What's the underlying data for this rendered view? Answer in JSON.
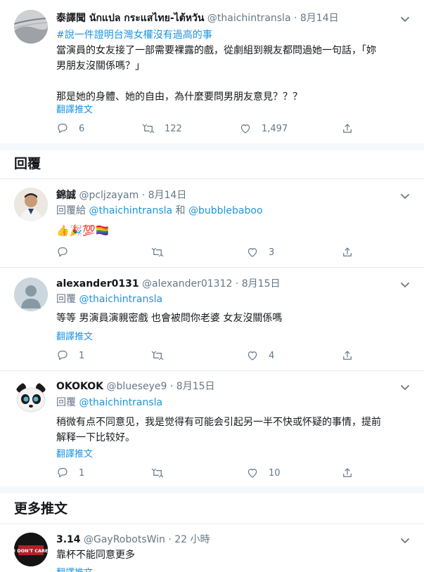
{
  "main_tweet": {
    "name": "泰譯聞 นักแปล กระแสไทย-ไต้หวัน",
    "handle": "@thaichintransla",
    "date": "· 8月14日",
    "hashtag": "#說一件證明台灣女權沒有過高的事",
    "line1": "當演員的女友接了一部需要裸露的戲，從劇組到親友都問過她一句話，「妳",
    "line2": "男朋友沒關係嗎？」",
    "line3": "那是她的身體、她的自由，為什麼要問男朋友意見？？？",
    "translate": "翻譯推文",
    "replies": "6",
    "retweets": "122",
    "likes": "1,497"
  },
  "replies_header": "回覆",
  "reply1": {
    "name": "錦誠",
    "handle": "@pcljzayam",
    "date": "· 8月14日",
    "reply_prefix": "回覆給",
    "reply_to1": "@thaichintransla",
    "reply_and": "和",
    "reply_to2": "@bubblebaboo",
    "emoji": "👍🎉💯🏳️‍🌈",
    "replies": "",
    "retweets": "",
    "likes": "3"
  },
  "reply2": {
    "name": "alexander0131",
    "handle": "@alexander01312",
    "date": "· 8月15日",
    "reply_prefix": "回覆",
    "reply_to": "@thaichintransla",
    "text": "等等 男演員演親密戲 也會被問你老婆 女友沒關係嗎",
    "translate": "翻譯推文",
    "replies": "1",
    "retweets": "",
    "likes": "4"
  },
  "reply3": {
    "name": "OKOKOK",
    "handle": "@blueseye9",
    "date": "· 8月15日",
    "reply_prefix": "回覆",
    "reply_to": "@thaichintransla",
    "line1": "稍微有点不同意见，我是觉得有可能会引起另一半不快或怀疑的事情，提前",
    "line2": "解释一下比较好。",
    "translate": "翻譯推文",
    "replies": "1",
    "retweets": "",
    "likes": "10"
  },
  "more_header": "更多推文",
  "more_tweet": {
    "name": "3.14",
    "handle": "@GayRobotsWin",
    "date": "· 22 小時",
    "avatar_text": "I DON'T CARE",
    "text": "靠杯不能同意更多",
    "translate": "翻譯推文"
  },
  "icons": {
    "reply": "reply-icon",
    "retweet": "retweet-icon",
    "like": "heart-icon",
    "share": "share-icon",
    "more": "chevron-down-icon"
  },
  "colors": {
    "link": "#1b95e0",
    "secondary": "#657786",
    "text": "#14171a",
    "divider": "#e6ecf0"
  }
}
